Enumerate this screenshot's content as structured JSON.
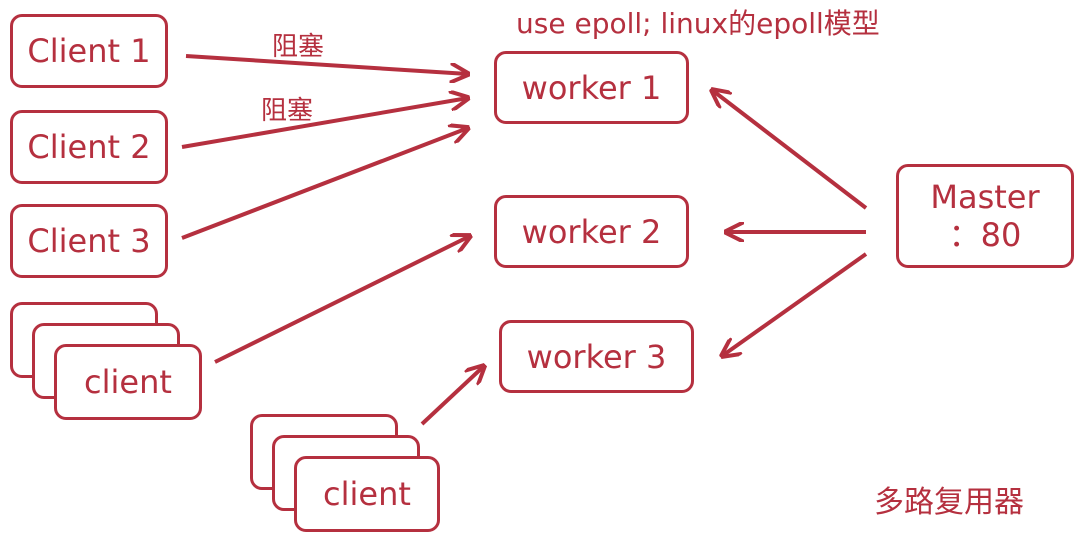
{
  "header": {
    "title": "use epoll; linux的epoll模型"
  },
  "clients": [
    {
      "label": "Client 1"
    },
    {
      "label": "Client 2"
    },
    {
      "label": "Client 3"
    }
  ],
  "client_groups": [
    {
      "label": "client"
    },
    {
      "label": "client"
    }
  ],
  "workers": [
    {
      "label": "worker 1"
    },
    {
      "label": "worker 2"
    },
    {
      "label": "worker 3"
    }
  ],
  "master": {
    "line1": "Master",
    "line2": "：80"
  },
  "edge_labels": {
    "block_1": "阻塞",
    "block_2": "阻塞"
  },
  "footer": {
    "caption": "多路复用器"
  },
  "colors": {
    "accent": "#b5303f"
  }
}
